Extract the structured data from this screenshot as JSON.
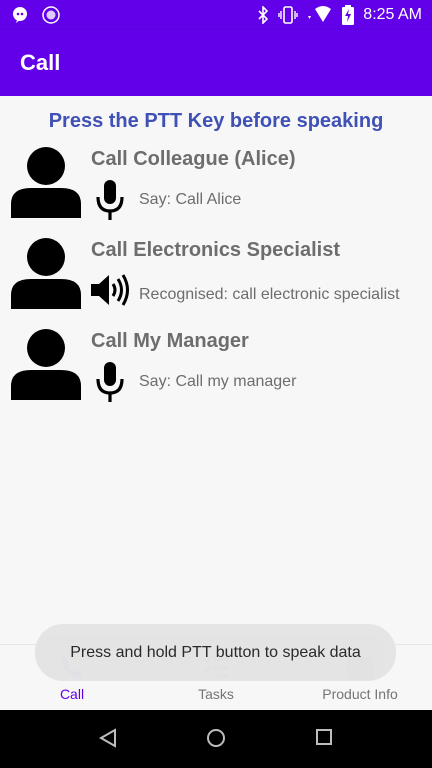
{
  "status_bar": {
    "time": "8:25 AM",
    "icons": [
      "message-bubble-icon",
      "app-dots-icon",
      "bluetooth-icon",
      "vibrate-icon",
      "wifi-icon",
      "battery-charging-icon"
    ]
  },
  "app_bar": {
    "title": "Call"
  },
  "instruction": "Press the PTT Key before speaking",
  "contacts": [
    {
      "name": "Call Colleague (Alice)",
      "status": "Say: Call Alice",
      "state_icon": "microphone-icon"
    },
    {
      "name": "Call Electronics Specialist",
      "status": "Recognised: call electronic specialist",
      "state_icon": "speaker-icon"
    },
    {
      "name": "Call My Manager",
      "status": "Say: Call my manager",
      "state_icon": "microphone-icon"
    }
  ],
  "toast": "Press and hold PTT button to speak data",
  "bottom_nav": {
    "items": [
      {
        "label": "Call",
        "icon": "phone-icon",
        "active": true
      },
      {
        "label": "Tasks",
        "icon": "checklist-icon",
        "active": false
      },
      {
        "label": "Product Info",
        "icon": "product-icon",
        "active": false
      }
    ]
  },
  "colors": {
    "primary": "#6200ea",
    "instruction": "#3f51b5",
    "text_gray": "#6d6d6d"
  }
}
